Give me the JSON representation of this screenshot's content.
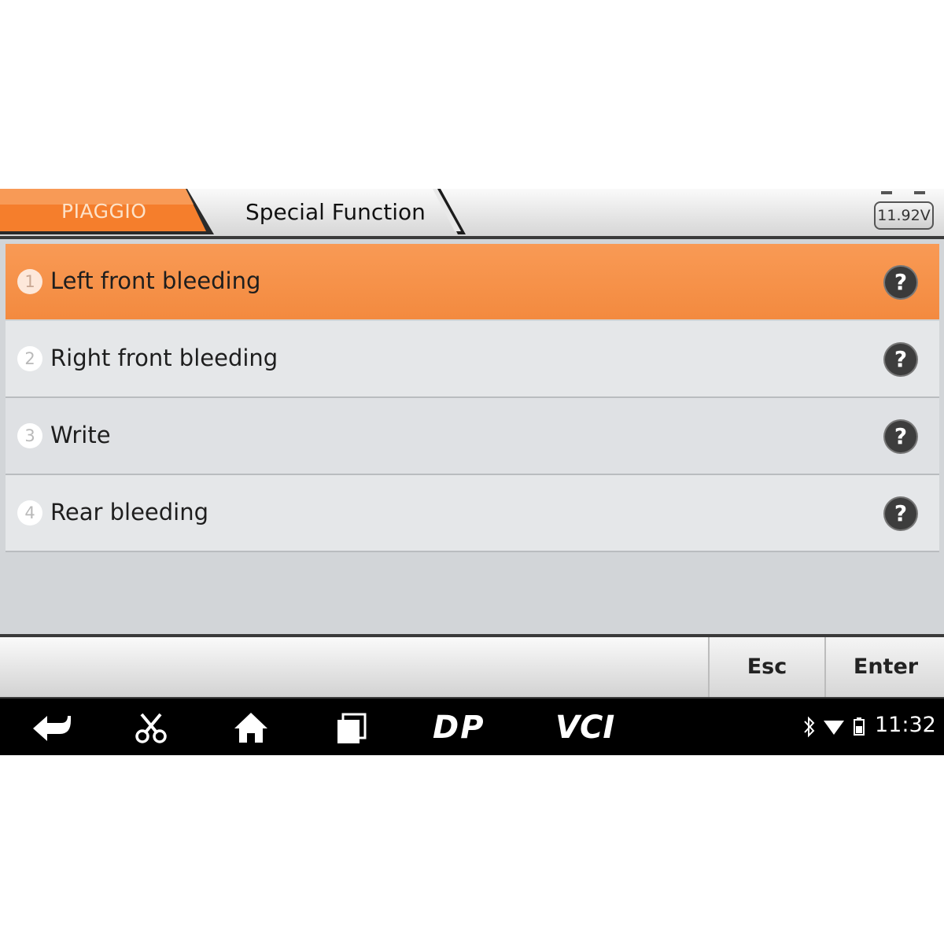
{
  "header": {
    "brand": "PIAGGIO",
    "breadcrumb": "Special Function",
    "voltage": "11.92V",
    "colors": {
      "brand_tab": "#f57e2c",
      "accent": "#f5934a"
    }
  },
  "menu": {
    "items": [
      {
        "number": "1",
        "label": "Left front bleeding",
        "selected": true
      },
      {
        "number": "2",
        "label": "Right front bleeding",
        "selected": false
      },
      {
        "number": "3",
        "label": "Write",
        "selected": false
      },
      {
        "number": "4",
        "label": "Rear bleeding",
        "selected": false
      }
    ],
    "help_glyph": "?",
    "help_icon": "question-mark-icon"
  },
  "footer": {
    "esc_label": "Esc",
    "enter_label": "Enter"
  },
  "navbar": {
    "icons": [
      "back-icon",
      "scissors-icon",
      "home-icon",
      "recent-apps-icon",
      "dp-icon",
      "vci-icon"
    ],
    "dp_label": "DP",
    "vci_label": "VCI",
    "status_icons": [
      "bluetooth-icon",
      "wifi-icon",
      "battery-icon"
    ],
    "time": "11:32"
  }
}
